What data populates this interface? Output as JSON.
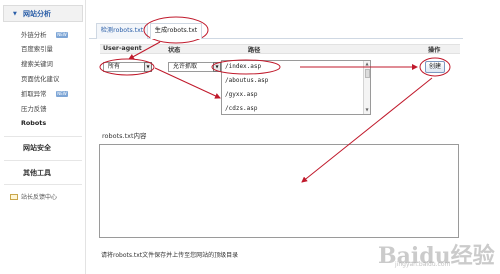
{
  "sidebar": {
    "section_title": "网站分析",
    "items": [
      {
        "label": "外链分析",
        "badge": "NEW"
      },
      {
        "label": "百度索引量",
        "badge": ""
      },
      {
        "label": "搜索关键词",
        "badge": ""
      },
      {
        "label": "页面优化建议",
        "badge": ""
      },
      {
        "label": "抓取异常",
        "badge": "NEW"
      },
      {
        "label": "压力反馈",
        "badge": ""
      },
      {
        "label": "Robots",
        "badge": ""
      }
    ],
    "groups": [
      "网站安全",
      "其他工具"
    ],
    "feedback": "站长反馈中心"
  },
  "tabs": {
    "check": "检测robots.txt",
    "generate": "生成robots.txt"
  },
  "table": {
    "headers": {
      "user_agent": "User-agent",
      "status": "状态",
      "path": "路径",
      "action": "操作"
    },
    "user_agent_value": "所有",
    "status_value": "允许抓取",
    "paths": [
      "/index.asp",
      "/aboutus.asp",
      "/gyxx.asp",
      "/cdzs.asp"
    ],
    "create_button": "创建"
  },
  "robots": {
    "title": "robots.txt内容",
    "content": "",
    "hint": "请将robots.txt文件保存并上传至您网站的顶级目录"
  },
  "watermark": {
    "main": "Baidu经验",
    "sub": "jingyan.baidu.com"
  },
  "colors": {
    "annotation": "#c0192b",
    "link": "#2a5ea8"
  }
}
